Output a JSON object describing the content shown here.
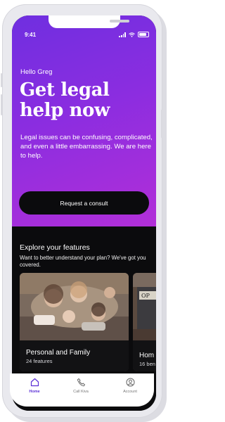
{
  "status_bar": {
    "time": "9:41"
  },
  "hero": {
    "greeting": "Hello Greg",
    "headline": "Get legal help now",
    "description": "Legal issues can be confusing, complicated, and even a little embarrassing. We are here to help.",
    "cta_label": "Request a consult"
  },
  "features": {
    "title": "Explore your features",
    "subtitle": "Want to better understand your plan? We've got you covered.",
    "cards": [
      {
        "title": "Personal and Family",
        "count": "24 features"
      },
      {
        "title": "Hom",
        "count": "16 ben"
      }
    ]
  },
  "tabbar": {
    "items": [
      {
        "label": "Home"
      },
      {
        "label": "Call Kiva"
      },
      {
        "label": "Account"
      }
    ]
  },
  "colors": {
    "accent_purple": "#6f2fe0",
    "accent_magenta": "#b22fd8",
    "tab_active": "#5b2fd6"
  }
}
